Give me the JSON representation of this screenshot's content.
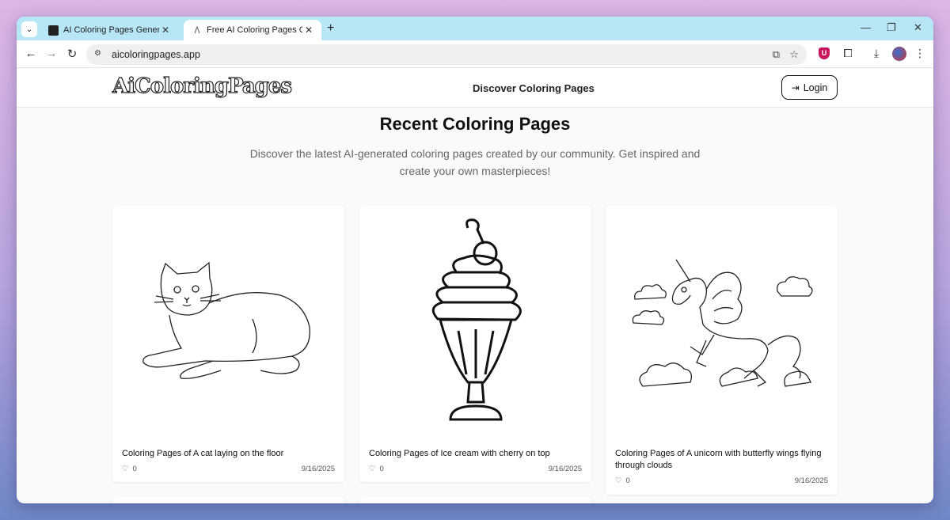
{
  "browser": {
    "tabs": [
      {
        "title": "AI Coloring Pages Generator | F",
        "active": false
      },
      {
        "title": "Free AI Coloring Pages Generat",
        "active": true
      }
    ],
    "url": "aicoloringpages.app"
  },
  "site": {
    "logo": "AiColoringPages",
    "nav_link": "Discover Coloring Pages",
    "login_label": "Login",
    "headline": "Recent Coloring Pages",
    "subtitle": "Discover the latest AI-generated coloring pages created by our community. Get inspired and create your own masterpieces!"
  },
  "cards": [
    {
      "caption": "Coloring Pages of A cat laying on the floor",
      "likes": "0",
      "date": "9/16/2025",
      "image": "cat-drawing"
    },
    {
      "caption": "Coloring Pages of Ice cream with cherry on top",
      "likes": "0",
      "date": "9/16/2025",
      "image": "ice-cream-drawing"
    },
    {
      "caption": "Coloring Pages of A unicorn with butterfly wings flying through clouds",
      "likes": "0",
      "date": "9/16/2025",
      "image": "unicorn-drawing"
    }
  ]
}
